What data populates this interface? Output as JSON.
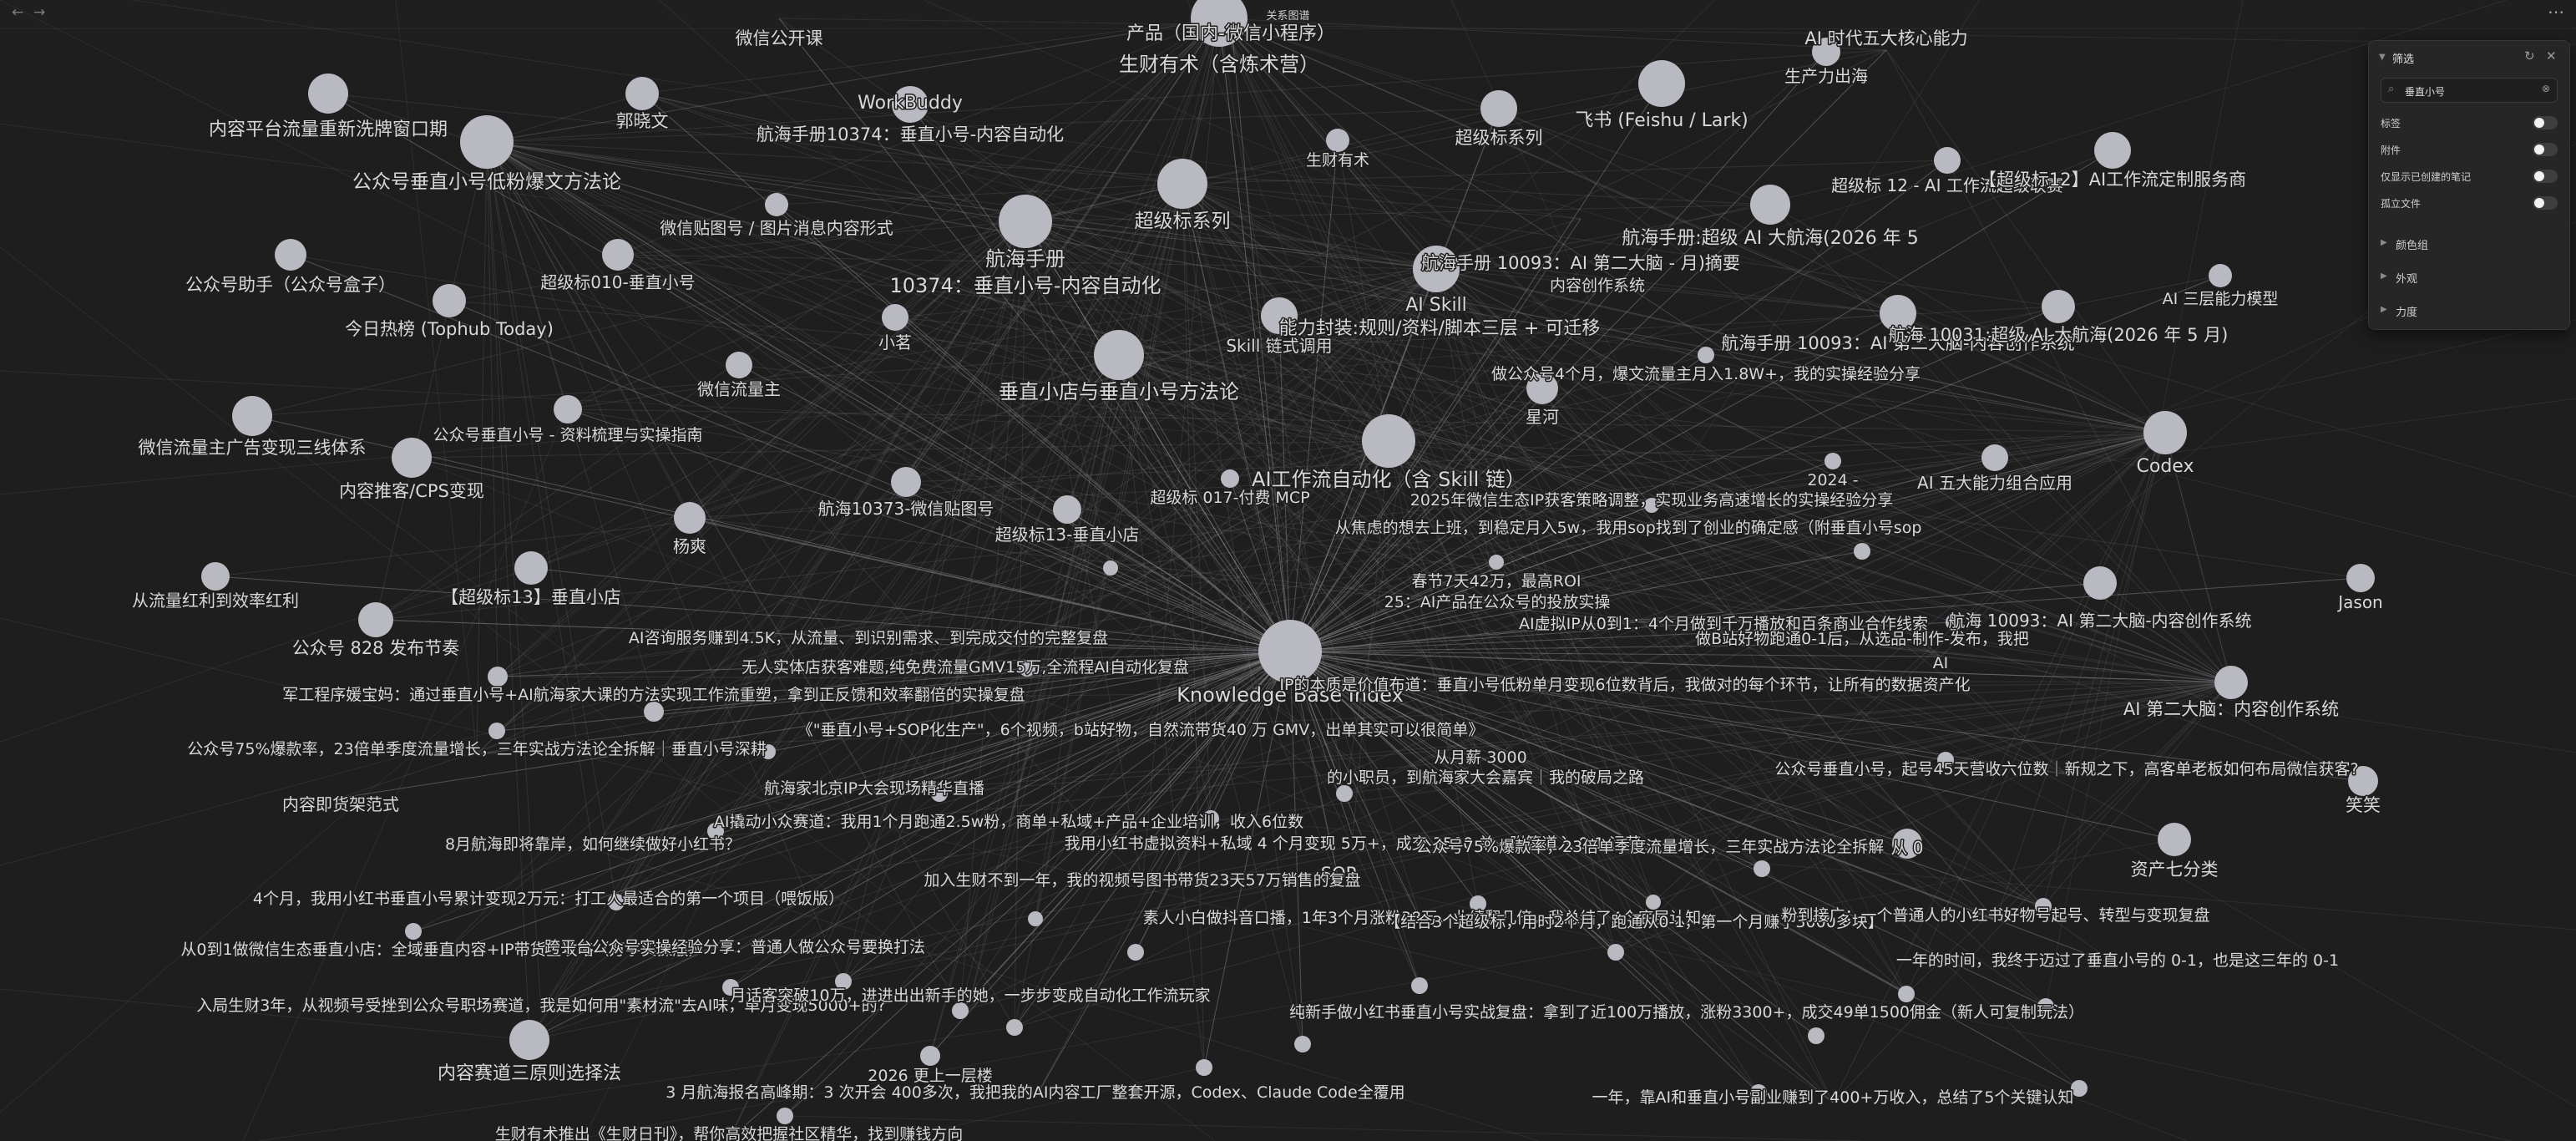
{
  "window": {
    "title": "关系图谱",
    "back_icon": "arrow-left-icon",
    "forward_icon": "arrow-right-icon",
    "menu_icon": "more-icon"
  },
  "filter_panel": {
    "title": "筛选",
    "search_value": "垂直小号",
    "options": [
      {
        "label": "标签",
        "on": false
      },
      {
        "label": "附件",
        "on": false
      },
      {
        "label": "仅显示已创建的笔记",
        "on": false
      },
      {
        "label": "孤立文件",
        "on": false
      }
    ],
    "sections": [
      "颜色组",
      "外观",
      "力度"
    ]
  },
  "colors": {
    "background": "#1e1e1e",
    "node": "#b9b9c2",
    "edge": "#9a9aa0",
    "label": "#d8d8d8"
  },
  "graph": {
    "nodes": [
      {
        "label": "Knowledge Base Index"
      },
      {
        "label": "AI工作流自动化（含 Skill 链）"
      },
      {
        "label": "垂直小店与垂直小号方法论"
      },
      {
        "label": "航海手册"
      },
      {
        "label": "10374：垂直小号-内容自动化"
      },
      {
        "label": "超级标系列"
      },
      {
        "label": "生财有术（含炼术营）"
      },
      {
        "label": "产品（国内-微信小程序）"
      },
      {
        "label": "WorkBuddy"
      },
      {
        "label": "公众号垂直小号低粉爆文方法论"
      },
      {
        "label": "内容平台流量重新洗牌窗口期"
      },
      {
        "label": "微信公开课"
      },
      {
        "label": "郭晓文"
      },
      {
        "label": "航海手册10374：垂直小号-内容自动化"
      },
      {
        "label": "生财有术"
      },
      {
        "label": "超级标系列"
      },
      {
        "label": "飞书 (Feishu / Lark)"
      },
      {
        "label": "生产力出海"
      },
      {
        "label": "AI 时代五大核心能力"
      },
      {
        "label": "超级标 12 - AI 工作流超级联赛"
      },
      {
        "label": "【超级标12】AI工作流定制服务商"
      },
      {
        "label": "航海手册:超级 AI 大航海(2026 年 5"
      },
      {
        "label": "航海手册 10093：AI 第二大脑 - 月)摘要"
      },
      {
        "label": "内容创作系统"
      },
      {
        "label": "AI Skill"
      },
      {
        "label": "能力封装:规则/资料/脚本三层 + 可迁移"
      },
      {
        "label": "Skill 链式调用"
      },
      {
        "label": "小茗"
      },
      {
        "label": "微信贴图号 / 图片消息内容形式"
      },
      {
        "label": "公众号助手（公众号盒子）"
      },
      {
        "label": "超级标010-垂直小号"
      },
      {
        "label": "今日热榜 (Tophub Today)"
      },
      {
        "label": "微信流量主"
      },
      {
        "label": "公众号垂直小号 - 资料梳理与实操指南"
      },
      {
        "label": "微信流量主广告变现三线体系"
      },
      {
        "label": "内容推客/CPS变现"
      },
      {
        "label": "航海10373-微信贴图号"
      },
      {
        "label": "超级标13-垂直小店"
      },
      {
        "label": "超级标 017-付费 MCP"
      },
      {
        "label": "杨爽"
      },
      {
        "label": "【超级标13】垂直小店"
      },
      {
        "label": "从流量红利到效率红利"
      },
      {
        "label": "公众号 828 发布节奏"
      },
      {
        "label": "星河"
      },
      {
        "label": "做公众号4个月，爆文流量主月入1.8W+，我的实操经验分享"
      },
      {
        "label": "航海手册 10093：AI 第二大脑-内容创作系统"
      },
      {
        "label": "航海 10031:超级 AI 大航海(2026 年 5 月)"
      },
      {
        "label": "AI 三层能力模型"
      },
      {
        "label": "Codex"
      },
      {
        "label": "AI 五大能力组合应用"
      },
      {
        "label": "2024 -"
      },
      {
        "label": "2025年微信生态IP获客策略调整，实现业务高速增长的实操经验分享"
      },
      {
        "label": "从焦虑的想去上班，到稳定月入5w，我用sop找到了创业的确定感（附垂直小号sop"
      },
      {
        "label": "春节7天42万，最高ROI"
      },
      {
        "label": "25：AI产品在公众号的投放实操"
      },
      {
        "label": "AI虚拟IP从0到1：4个月做到千万播放和百条商业合作线索"
      },
      {
        "label": "做B站好物跑通0-1后，从选品-制作-发布，我把"
      },
      {
        "label": "AI"
      },
      {
        "label": "航海 10093：AI 第二大脑-内容创作系统"
      },
      {
        "label": "Jason"
      },
      {
        "label": "AI 第二大脑：内容创作系统"
      },
      {
        "label": "AI咨询服务赚到4.5K，从流量、到识别需求、到完成交付的完整复盘"
      },
      {
        "label": "无人实体店获客难题,纯免费流量GMV15万,全流程AI自动化复盘"
      },
      {
        "label": "军工程序媛宝妈：通过垂直小号+AI航海家大课的方法实现工作流重塑，拿到正反馈和效率翻倍的实操复盘"
      },
      {
        "label": "IP的本质是价值布道：垂直小号低粉单月变现6位数背后，我做对的每个环节，让所有的数据资产化"
      },
      {
        "label": "《\"垂直小号+SOP化生产\"，6个视频，b站好物，自然流带货40 万 GMV，出单其实可以很简单》"
      },
      {
        "label": "公众号75%爆款率，23倍单季度流量增长，三年实战方法论全拆解｜垂直小号深耕"
      },
      {
        "label": "从月薪 3000"
      },
      {
        "label": "的小职员，到航海家大会嘉宾｜我的破局之路"
      },
      {
        "label": "公众号垂直小号，起号45天营收六位数｜新规之下，高客单老板如何布局微信获客?"
      },
      {
        "label": "笑笑"
      },
      {
        "label": "内容即货架范式"
      },
      {
        "label": "航海家北京IP大会现场精华直播"
      },
      {
        "label": "AI撬动小众赛道：我用1个月跑通2.5w粉，商单+私域+产品+企业培训，收入6位数"
      },
      {
        "label": "我用小红书虚拟资料+私域 4 个月变现 5万+，成交 3500 单，附管道入 0-1 运营"
      },
      {
        "label": "公众号75%爆款率，23倍单季度流量增长，三年实战方法论全拆解"
      },
      {
        "label": "从 0"
      },
      {
        "label": "资产七分类"
      },
      {
        "label": "8月航海即将靠岸，如何继续做好小红书？"
      },
      {
        "label": "SOP"
      },
      {
        "label": "4个月，我用小红书垂直小号累计变现2万元：打工人最适合的第一个项目（喂饭版）"
      },
      {
        "label": "加入生财不到一年，我的视频号图书带货23天57万销售的复盘"
      },
      {
        "label": "素人小白做抖音口播，1年3个月涨粉38万，业绩翻几倍，我总结了4个底层认知"
      },
      {
        "label": "【结合3个超级标，用时2个月，跑通从0-1，第一个月赚了3000多块】"
      },
      {
        "label": "粉到接广：一个普通人的小红书好物号起号、转型与变现复盘"
      },
      {
        "label": "从0到1做微信生态垂直小店：全域垂直内容+IP带货全攻略（万字实操版）"
      },
      {
        "label": "跨平台公众号实操经验分享：普通人做公众号要换打法"
      },
      {
        "label": "入局生财3年，从视频号受挫到公众号职场赛道，我是如何用\"素材流\"去AI味，单月变现5000+的?"
      },
      {
        "label": "月话客突破10万，进进出出新手的她，一步步变成自动化工作流玩家"
      },
      {
        "label": "纯新手做小红书垂直小号实战复盘：拿到了近100万播放，涨粉3300+，成交49单1500佣金（新人可复制玩法）"
      },
      {
        "label": "内容赛道三原则选择法"
      },
      {
        "label": "2026 更上一层楼"
      },
      {
        "label": "3 月航海报名高峰期：3 次开会 400多次，我把我的AI内容工厂整套开源，Codex、Claude Code全覆用"
      },
      {
        "label": "一年，靠AI和垂直小号副业赚到了400+万收入，总结了5个关键认知"
      },
      {
        "label": "生财有术推出《生财日刊》，帮你高效把握社区精华，找到赚钱方向"
      },
      {
        "label": "一年的时间，我终于迈过了垂直小号的 0-1，也是这三年的 0-1"
      }
    ]
  }
}
